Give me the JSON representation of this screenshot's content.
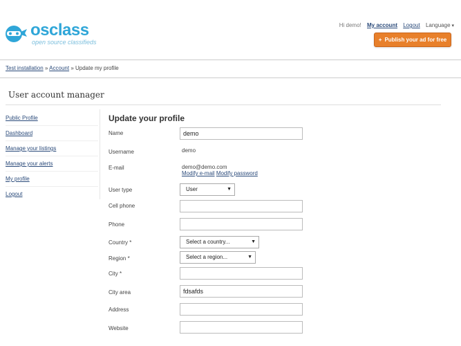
{
  "header": {
    "logo_text": "osclass",
    "logo_tagline": "open source classifieds",
    "greeting": "Hi demo!",
    "my_account": "My account",
    "logout": "Logout",
    "language": "Language",
    "publish_label": "Publish your ad for free",
    "publish_color": "#e8802b"
  },
  "breadcrumb": {
    "home": "Test installation",
    "account": "Account",
    "current": "Update my profile",
    "sep": "»"
  },
  "page_title": "User account manager",
  "sidebar": {
    "items": [
      {
        "label": "Public Profile"
      },
      {
        "label": "Dashboard"
      },
      {
        "label": "Manage your listings"
      },
      {
        "label": "Manage your alerts"
      },
      {
        "label": "My profile"
      },
      {
        "label": "Logout"
      }
    ]
  },
  "form": {
    "title": "Update your profile",
    "name_label": "Name",
    "name_value": "demo",
    "username_label": "Username",
    "username_value": "demo",
    "email_label": "E-mail",
    "email_value": "demo@demo.com",
    "modify_email": "Modify e-mail",
    "modify_password": "Modify password",
    "user_type_label": "User type",
    "user_type_value": "User",
    "cell_phone_label": "Cell phone",
    "cell_phone_value": "",
    "phone_label": "Phone",
    "phone_value": "",
    "country_label": "Country *",
    "country_value": "Select a country...",
    "region_label": "Region *",
    "region_value": "Select a region...",
    "city_label": "City *",
    "city_value": "",
    "city_area_label": "City area",
    "city_area_value": "fdsafds",
    "address_label": "Address",
    "address_value": "",
    "website_label": "Website",
    "website_value": ""
  }
}
